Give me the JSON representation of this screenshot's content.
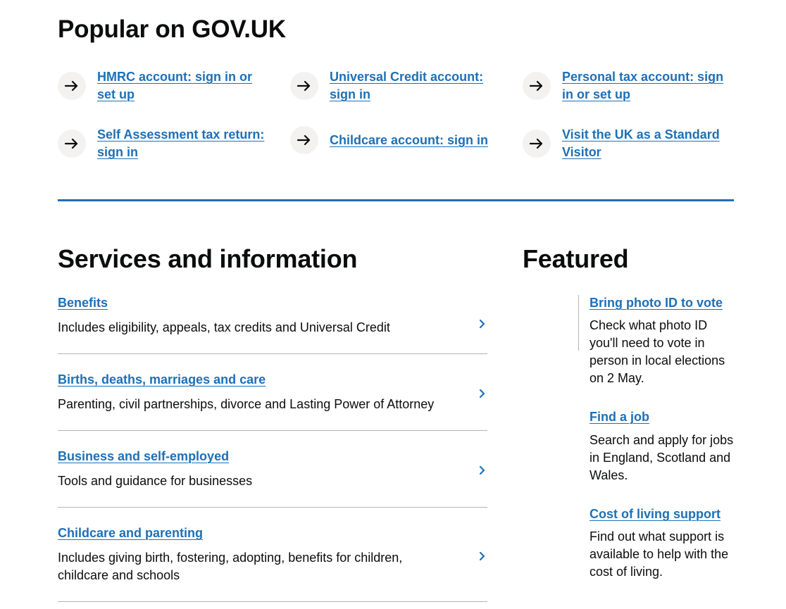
{
  "popular": {
    "title": "Popular on GOV.UK",
    "links": [
      {
        "label": "HMRC account: sign in or set up"
      },
      {
        "label": "Universal Credit account: sign in"
      },
      {
        "label": "Personal tax account: sign in or set up"
      },
      {
        "label": "Self Assessment tax return: sign in"
      },
      {
        "label": "Childcare account: sign in"
      },
      {
        "label": "Visit the UK as a Standard Visitor"
      }
    ]
  },
  "services": {
    "title": "Services and information",
    "items": [
      {
        "title": "Benefits",
        "description": "Includes eligibility, appeals, tax credits and Universal Credit"
      },
      {
        "title": "Births, deaths, marriages and care",
        "description": "Parenting, civil partnerships, divorce and Lasting Power of Attorney"
      },
      {
        "title": "Business and self-employed",
        "description": "Tools and guidance for businesses"
      },
      {
        "title": "Childcare and parenting",
        "description": "Includes giving birth, fostering, adopting, benefits for children, childcare and schools"
      }
    ]
  },
  "featured": {
    "title": "Featured",
    "items": [
      {
        "title": "Bring photo ID to vote",
        "description": "Check what photo ID you'll need to vote in person in local elections on 2 May."
      },
      {
        "title": "Find a job",
        "description": "Search and apply for jobs in England, Scotland and Wales."
      },
      {
        "title": "Cost of living support",
        "description": "Find out what support is available to help with the cost of living."
      }
    ]
  },
  "colors": {
    "link": "#1d70b8",
    "text": "#0b0c0c",
    "divider": "#b1b4b6",
    "arrow_bg": "#f3f2f1"
  },
  "icons": {
    "popular_arrow": "arrow-right-icon",
    "service_chevron": "chevron-right-icon"
  }
}
